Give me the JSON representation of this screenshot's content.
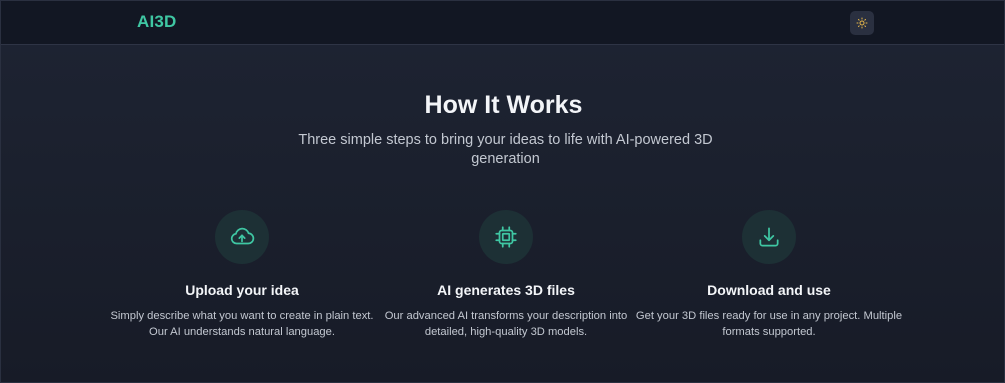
{
  "nav": {
    "logo": "AI3D",
    "theme_toggle_icon": "sun-icon"
  },
  "hero": {
    "title": "How It Works",
    "subtitle": "Three simple steps to bring your ideas to life with AI-powered 3D generation"
  },
  "steps": [
    {
      "icon": "cloud-upload-icon",
      "title": "Upload your idea",
      "description": "Simply describe what you want to create in plain text. Our AI understands natural language."
    },
    {
      "icon": "cpu-chip-icon",
      "title": "AI generates 3D files",
      "description": "Our advanced AI transforms your description into detailed, high-quality 3D models."
    },
    {
      "icon": "download-icon",
      "title": "Download and use",
      "description": "Get your 3D files ready for use in any project. Multiple formats supported."
    }
  ],
  "colors": {
    "accent": "#3fc7a3",
    "background": "#1b2030",
    "navbar": "#121723",
    "icon_circle": "#1d3035",
    "sun": "#e8b84a"
  }
}
